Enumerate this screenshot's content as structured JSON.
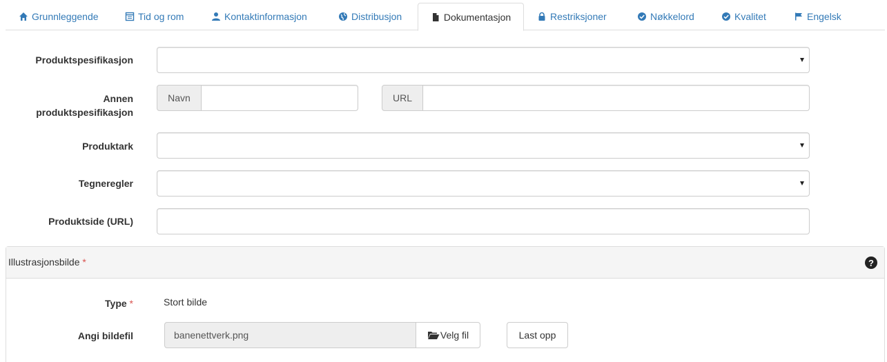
{
  "tabs": [
    {
      "label": "Grunnleggende",
      "icon": "home-icon"
    },
    {
      "label": "Tid og rom",
      "icon": "calendar-icon"
    },
    {
      "label": "Kontaktinformasjon",
      "icon": "user-icon"
    },
    {
      "label": "Distribusjon",
      "icon": "globe-icon"
    },
    {
      "label": "Dokumentasjon",
      "icon": "file-icon",
      "active": true
    },
    {
      "label": "Restriksjoner",
      "icon": "lock-icon"
    },
    {
      "label": "Nøkkelord",
      "icon": "check-circle-icon"
    },
    {
      "label": "Kvalitet",
      "icon": "check-circle-icon"
    },
    {
      "label": "Engelsk",
      "icon": "flag-icon"
    }
  ],
  "form": {
    "produktspesifikasjon_label": "Produktspesifikasjon",
    "annen_label_1": "Annen",
    "annen_label_2": "produktspesifikasjon",
    "navn_addon": "Navn",
    "url_addon": "URL",
    "produktark_label": "Produktark",
    "tegneregler_label": "Tegneregler",
    "produktside_label": "Produktside (URL)"
  },
  "panel": {
    "title": "Illustrasjonsbilde",
    "required_mark": "*",
    "help": "?",
    "type_label": "Type",
    "type_value": "Stort bilde",
    "file_label": "Angi bildefil",
    "file_value": "banenettverk.png",
    "choose_button": "Velg fil",
    "upload_button": "Last opp"
  },
  "colors": {
    "link": "#337ab7",
    "required": "#d9534f"
  }
}
